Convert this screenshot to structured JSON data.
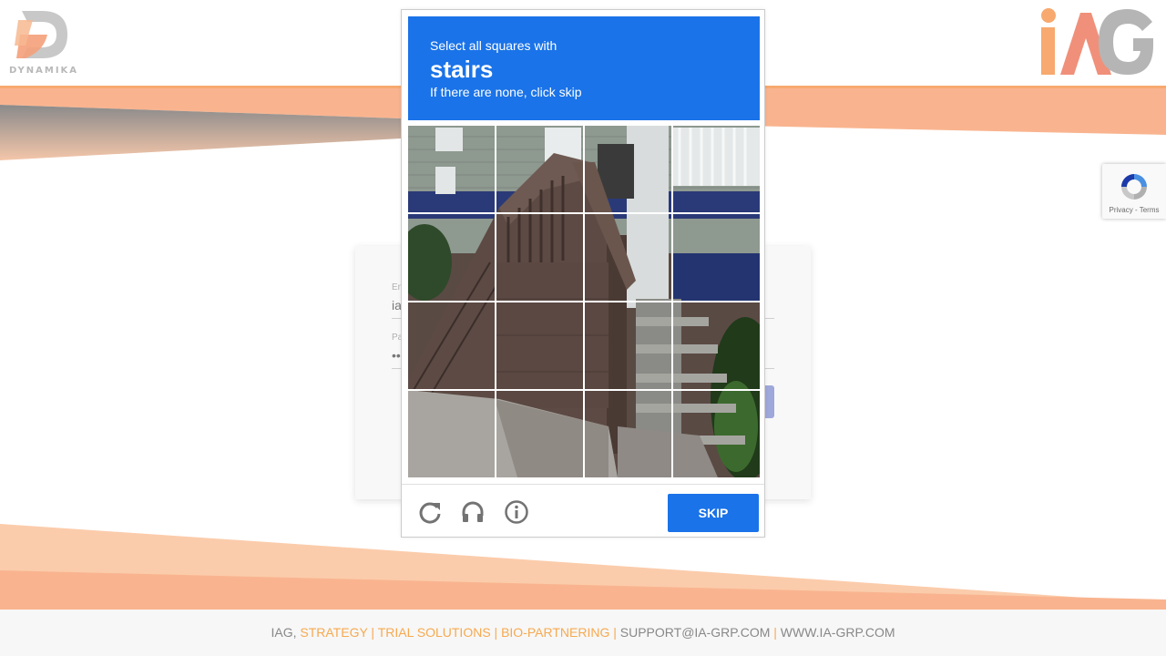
{
  "colors": {
    "accent_orange": "#f7a94f",
    "band_orange": "#f9b48f",
    "captcha_blue": "#1a73e8",
    "login_button": "#9fa8da"
  },
  "brand": {
    "left_logo_text": "DYNAMIKA",
    "left_logo_icon": "dynamika-d-logo-icon",
    "right_logo_icon": "iag-logo-icon"
  },
  "login": {
    "email_label": "En",
    "email_value": "ia",
    "password_label": "Pa",
    "password_value": "••"
  },
  "captcha": {
    "instruction": "Select all squares with",
    "keyword": "stairs",
    "subtext": "If there are none, click skip",
    "grid": {
      "rows": 4,
      "cols": 4
    },
    "reload_icon": "reload-icon",
    "audio_icon": "headphones-icon",
    "info_icon": "info-icon",
    "skip_label": "SKIP"
  },
  "recaptcha_badge": {
    "links": "Privacy - Terms",
    "icon": "recaptcha-logo-icon"
  },
  "footer": {
    "prefix": "IAG,",
    "services": "STRATEGY | TRIAL SOLUTIONS | BIO-PARTNERING |",
    "email": "SUPPORT@IA-GRP.COM",
    "separator": "|",
    "website": "WWW.IA-GRP.COM"
  }
}
